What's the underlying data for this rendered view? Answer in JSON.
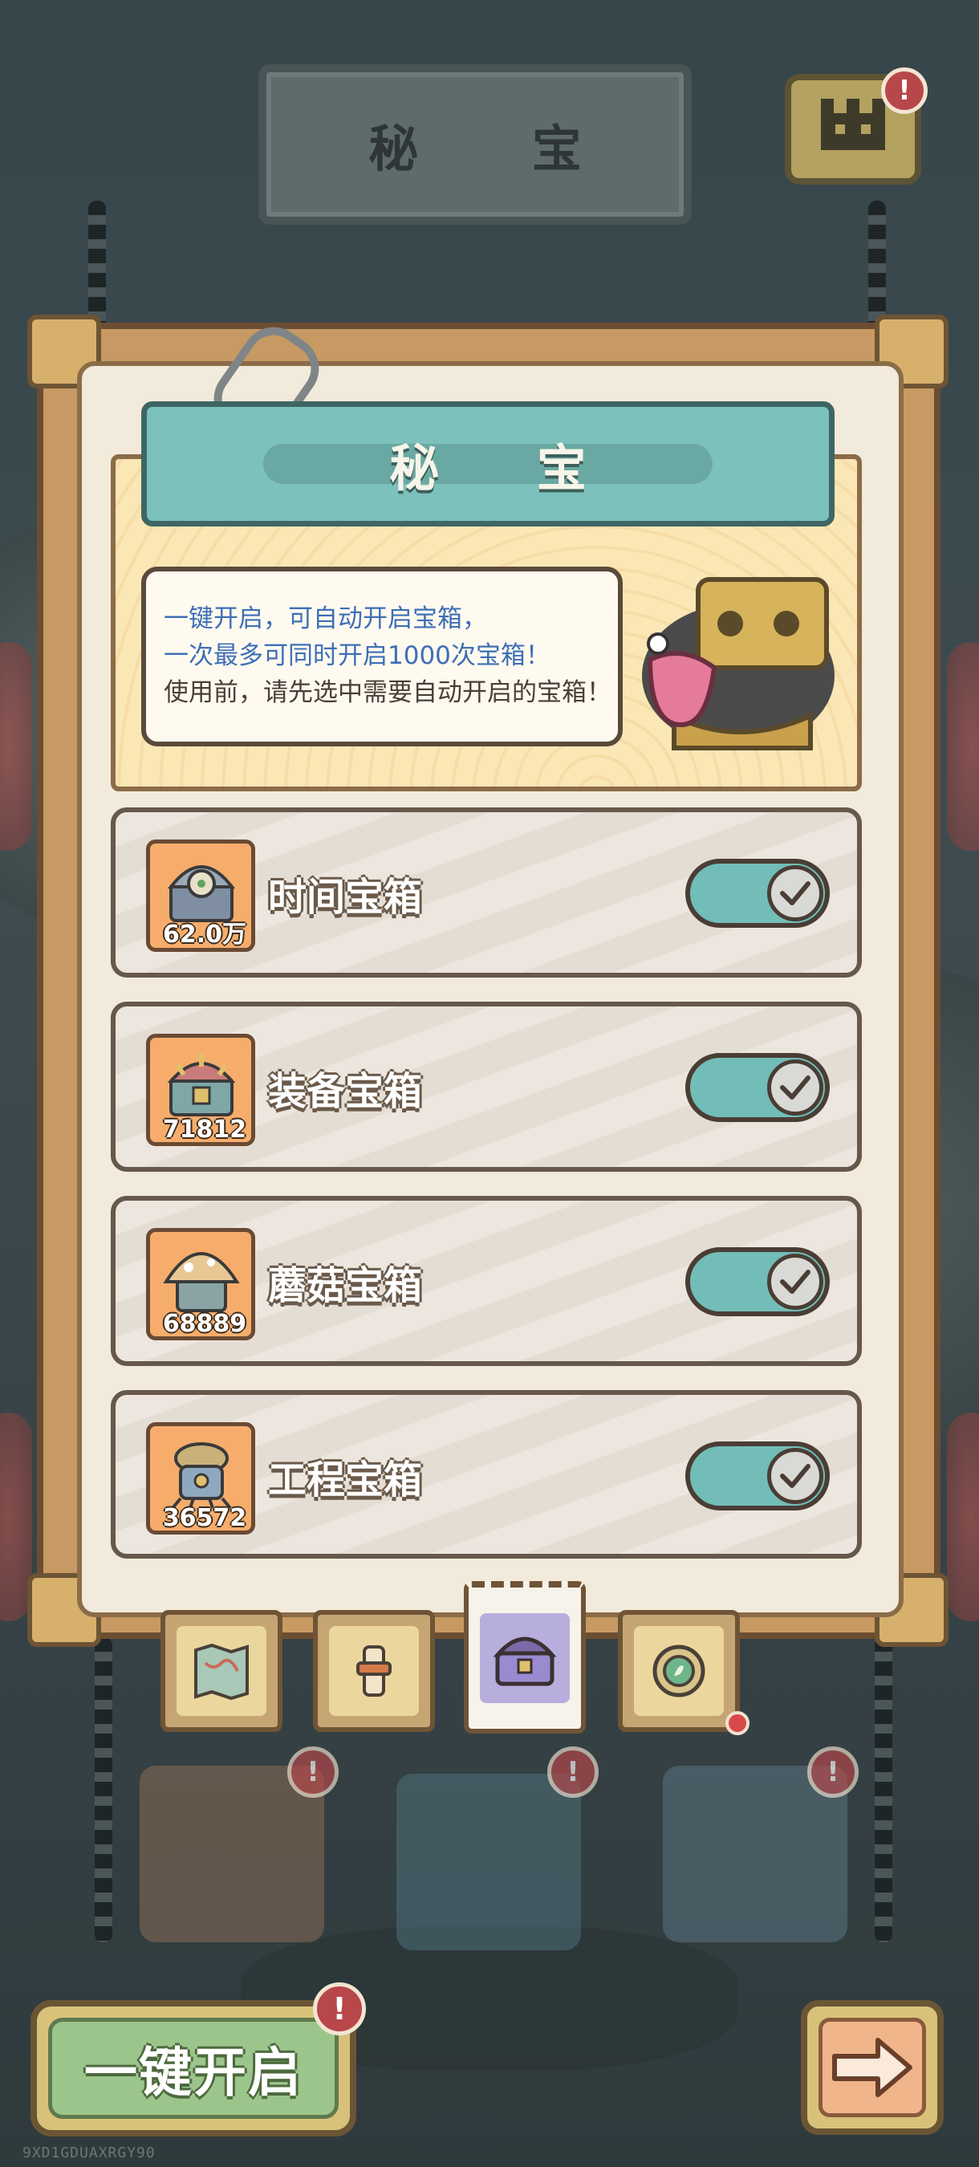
{
  "header": {
    "sign_title": "秘 宝",
    "top_right_icon": "castle-icon",
    "alert_mark": "!"
  },
  "panel": {
    "title": "秘 宝",
    "description": {
      "line1": "一键开启，可自动开启宝箱，",
      "line2": "一次最多可同时开启1000次宝箱！",
      "line3": "使用前，请先选中需要自动开启的宝箱！"
    },
    "rows": [
      {
        "label": "时间宝箱",
        "count": "62.0万",
        "icon": "time-chest-icon",
        "enabled": true
      },
      {
        "label": "装备宝箱",
        "count": "71812",
        "icon": "equipment-chest-icon",
        "enabled": true
      },
      {
        "label": "蘑菇宝箱",
        "count": "68889",
        "icon": "mushroom-chest-icon",
        "enabled": true
      },
      {
        "label": "工程宝箱",
        "count": "36572",
        "icon": "engineering-chest-icon",
        "enabled": true
      }
    ]
  },
  "tabs": [
    {
      "name": "map",
      "icon": "map-icon",
      "active": false
    },
    {
      "name": "scroll",
      "icon": "scroll-icon",
      "active": false
    },
    {
      "name": "treasure",
      "icon": "treasure-chest-icon",
      "active": true
    },
    {
      "name": "compass",
      "icon": "compass-icon",
      "active": false,
      "has_dot": true
    }
  ],
  "footer": {
    "open_all_label": "一键开启",
    "alert_mark": "!",
    "next_icon": "arrow-right-icon",
    "watermark": "9XD1GDUAXRGY90"
  },
  "colors": {
    "title_teal": "#7cc1bb",
    "desc_blue": "#3d6fb6",
    "toggle_on": "#72bdb8",
    "alert_red": "#b8474a"
  }
}
